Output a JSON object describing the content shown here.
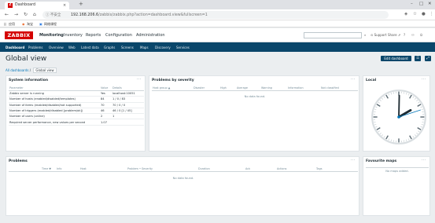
{
  "browser": {
    "tab_title": "Dashboard",
    "tab_close": "×",
    "new_tab": "+",
    "window_controls": [
      "–",
      "□",
      "✕"
    ],
    "nav": {
      "back": "←",
      "forward": "→",
      "reload": "↻",
      "home": "⌂"
    },
    "security_label": "ⓘ 不安全",
    "url_host": "192.168.206.6",
    "url_path": "/zabbix/zabbix.php?action=dashboard.view&fullscreen=1",
    "bookmarks": [
      "应用",
      "淘宝",
      "网络课程"
    ]
  },
  "header": {
    "logo": "ZABBIX",
    "menu": [
      "Monitoring",
      "Inventory",
      "Reports",
      "Configuration",
      "Administration"
    ],
    "right_items": [
      "Support",
      "Share",
      "?"
    ]
  },
  "submenu": [
    "Dashboard",
    "Problems",
    "Overview",
    "Web",
    "Latest data",
    "Graphs",
    "Screens",
    "Maps",
    "Discovery",
    "Services"
  ],
  "page": {
    "title": "Global view",
    "edit_button": "Edit dashboard",
    "crumb_all": "All dashboards",
    "crumb_sep": "/",
    "crumb_current": "Global view"
  },
  "system_info": {
    "title": "System information",
    "menu": "···",
    "columns": [
      "Parameter",
      "Value",
      "Details"
    ],
    "rows": [
      {
        "param": "Zabbix server is running",
        "value": "Yes",
        "details": "localhost:10051"
      },
      {
        "param": "Number of hosts (enabled/disabled/templates)",
        "value": "84",
        "details": "1 / 0 / 83"
      },
      {
        "param": "Number of items (enabled/disabled/not supported)",
        "value": "70",
        "details": "70 / 0 / 0"
      },
      {
        "param": "Number of triggers (enabled/disabled [problem/ok])",
        "value": "46",
        "details": "46 / 0 [1 / 45]"
      },
      {
        "param": "Number of users (online)",
        "value": "2",
        "details": "1"
      },
      {
        "param": "Required server performance, new values per second",
        "value": "1.07",
        "details": ""
      }
    ]
  },
  "problems_by_severity": {
    "title": "Problems by severity",
    "menu": "···",
    "columns": [
      "Host group ▲",
      "Disaster",
      "High",
      "Average",
      "Warning",
      "Information",
      "Not classified"
    ],
    "empty": "No data found."
  },
  "local_clock": {
    "title": "Local",
    "menu": "···",
    "time": {
      "hours": 2,
      "minutes": 0,
      "seconds": 12
    }
  },
  "problems": {
    "title": "Problems",
    "menu": "···",
    "columns": [
      "Time ▼",
      "Info",
      "Host",
      "Problem • Severity",
      "Duration",
      "Ack",
      "Actions",
      "Tags"
    ],
    "empty": "No data found."
  },
  "favourite_maps": {
    "title": "Favourite maps",
    "menu": "···",
    "empty": "No maps added."
  },
  "colors": {
    "zabbix_red": "#d40000",
    "nav_blue": "#0a466a",
    "link_blue": "#0275b8",
    "ok_green": "#429e47"
  }
}
